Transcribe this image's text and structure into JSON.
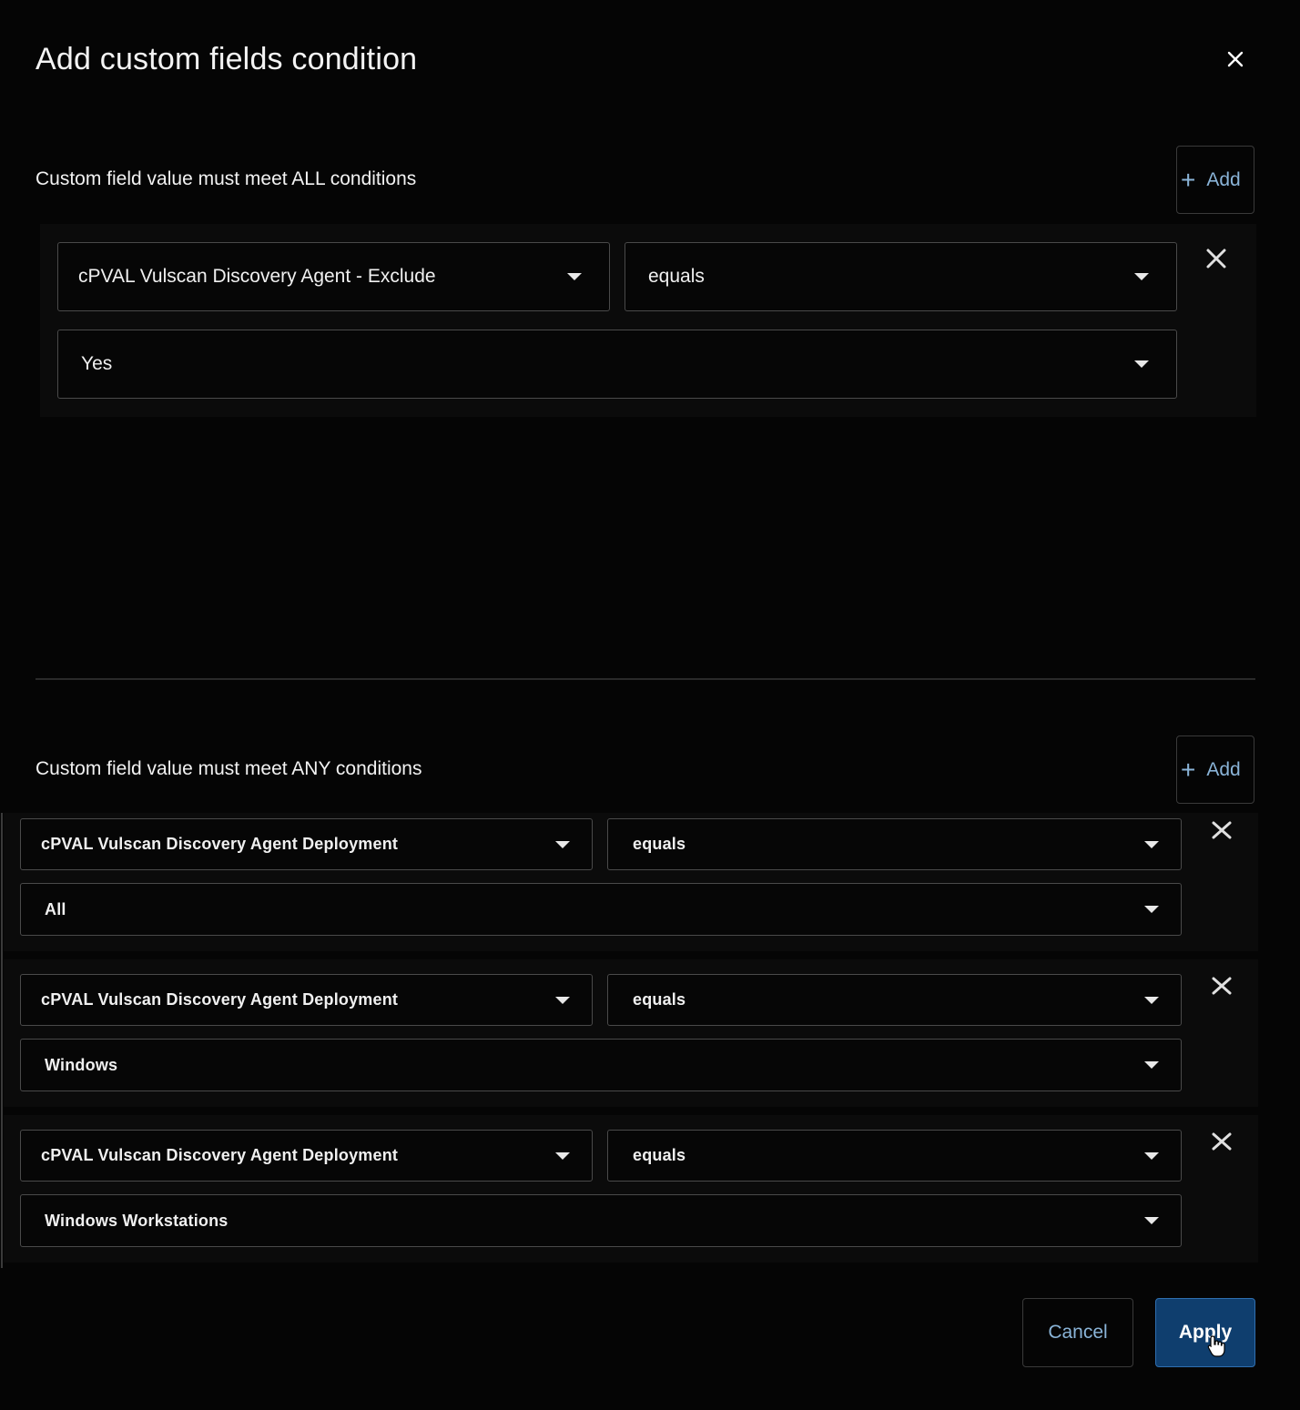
{
  "dialog": {
    "title": "Add custom fields condition"
  },
  "all_section": {
    "label": "Custom field value must meet ALL conditions",
    "add_label": "Add",
    "conditions": [
      {
        "field": "cPVAL Vulscan Discovery Agent - Exclude",
        "operator": "equals",
        "value": "Yes"
      }
    ]
  },
  "any_section": {
    "label": "Custom field value must meet ANY conditions",
    "add_label": "Add",
    "conditions": [
      {
        "field": "cPVAL Vulscan Discovery Agent Deployment",
        "operator": "equals",
        "value": "All"
      },
      {
        "field": "cPVAL Vulscan Discovery Agent Deployment",
        "operator": "equals",
        "value": "Windows"
      },
      {
        "field": "cPVAL Vulscan Discovery Agent Deployment",
        "operator": "equals",
        "value": "Windows Workstations"
      }
    ]
  },
  "footer": {
    "cancel_label": "Cancel",
    "apply_label": "Apply"
  },
  "colors": {
    "background": "#050505",
    "accent_link": "#8ab4d8",
    "primary_button": "#0f3e6e"
  },
  "icons": {
    "close": "close-icon",
    "add": "plus-icon",
    "dropdown": "caret-down-icon",
    "remove": "remove-condition-icon",
    "cursor": "pointer-cursor-icon"
  }
}
